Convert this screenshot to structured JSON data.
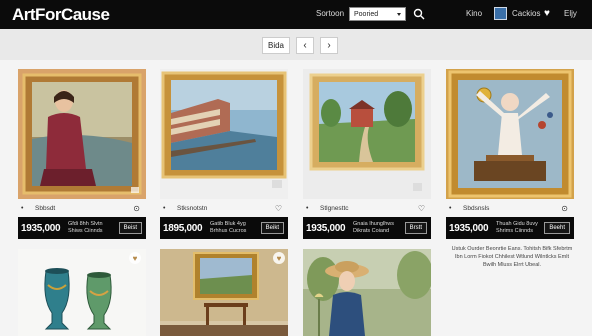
{
  "app": {
    "logo": "ArtForCause"
  },
  "topbar": {
    "sort_label": "Sortoon",
    "sort_value": "Pooried",
    "nav_link_1": "Kino",
    "nav_link_2": "Cackios",
    "nav_link_3": "Eljy"
  },
  "subbar": {
    "filter_label": "Bida",
    "prev_label": "‹",
    "next_label": "›"
  },
  "cards": [
    {
      "name": "Sbbsdt",
      "action": "⊙",
      "price": "1935,000",
      "meta_line1": "Gfdi 8hh Slvtn",
      "meta_line2": "Shiws Ciinnds",
      "buy_label": "Beist"
    },
    {
      "name": "Stksnotstn",
      "action": "♡",
      "price": "1895,000",
      "meta_line1": "Gatib Bluk 4yg",
      "meta_line2": "Brhhus Cucros",
      "buy_label": "Beikt"
    },
    {
      "name": "Stlgnesttc",
      "action": "♡",
      "price": "1935,000",
      "meta_line1": "Gnaia Ihunglhws",
      "meta_line2": "Dikrats Coiand",
      "buy_label": "Brstt"
    },
    {
      "name": "Sbdsnsls",
      "action": "⊙",
      "price": "1935,000",
      "meta_line1": "Thuah Gidu 8uvy",
      "meta_line2": "Shrims Ciinnds",
      "buy_label": "Beeht"
    }
  ],
  "description": "Ustuk Ourder Beonrtie Eans. Tohitsh Bifk Sfebrtm Ibn Lorm Fiokot Chhilest Wtlund Wilntlcks Emlt Bwilh Mluss Elrrt Ubeal."
}
